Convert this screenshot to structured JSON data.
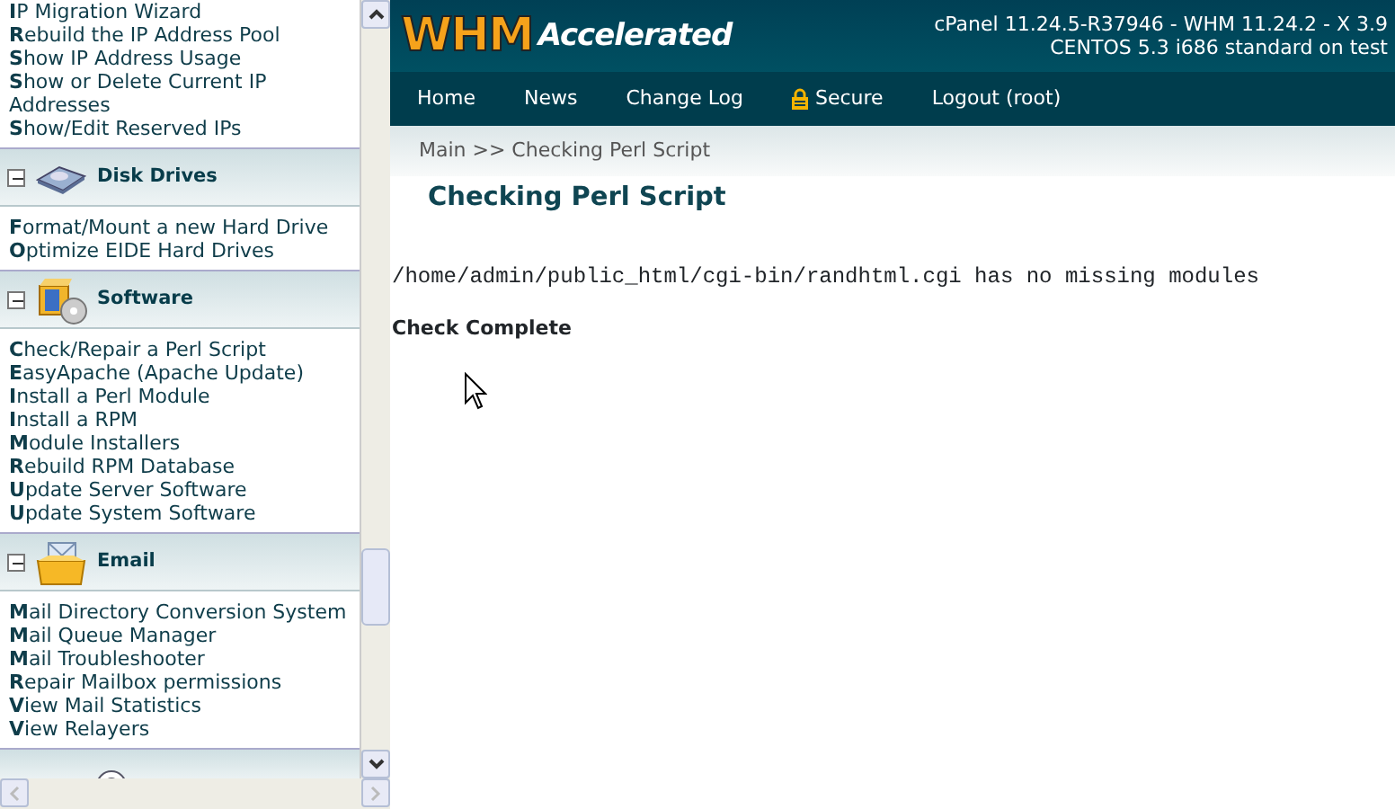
{
  "sidebar": {
    "sections": [
      {
        "kind": "list",
        "items": [
          "**I**P Migration Wizard",
          "**R**ebuild the IP Address Pool",
          "**S**how IP Address Usage",
          "**S**how or Delete Current IP Addresses",
          "**S**how/Edit Reserved IPs"
        ]
      },
      {
        "kind": "group",
        "title": "Disk Drives",
        "expanded": true,
        "items": [
          "**F**ormat/Mount a new Hard Drive",
          "**O**ptimize EIDE Hard Drives"
        ]
      },
      {
        "kind": "group",
        "title": "Software",
        "expanded": true,
        "items": [
          "**C**heck/Repair a Perl Script",
          "**E**asyApache (Apache Update)",
          "**I**nstall a Perl Module",
          "**I**nstall a RPM",
          "**M**odule Installers",
          "**R**ebuild RPM Database",
          "**U**pdate Server Software",
          "**U**pdate System Software"
        ]
      },
      {
        "kind": "group",
        "title": "Email",
        "expanded": true,
        "items": [
          "**M**ail Directory Conversion System",
          "**M**ail Queue Manager",
          "**M**ail Troubleshooter",
          "**R**epair Mailbox permissions",
          "**V**iew Mail Statistics",
          "**V**iew Relayers"
        ]
      },
      {
        "kind": "partial"
      }
    ]
  },
  "header": {
    "logo": "WHM",
    "logo_sub": "Accelerated",
    "version_lines": [
      "cPanel 11.24.5-R37946 - WHM 11.24.2 - X 3.9",
      "CENTOS 5.3 i686 standard on test"
    ]
  },
  "nav": [
    {
      "label": "Home",
      "kind": "link"
    },
    {
      "label": "News",
      "kind": "link"
    },
    {
      "label": "Change Log",
      "kind": "link"
    },
    {
      "label": "Secure",
      "kind": "lock"
    },
    {
      "label": "Logout (root)",
      "kind": "link"
    }
  ],
  "breadcrumb": "Main >> Checking Perl Script",
  "page_title": "Checking Perl Script",
  "output": [
    "/home/admin/public_html/cgi-bin/randhtml.cgi has no missing modules"
  ],
  "status": "Check Complete"
}
